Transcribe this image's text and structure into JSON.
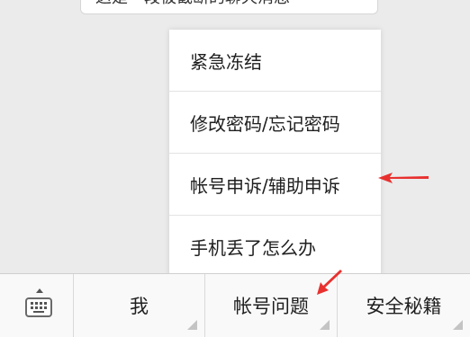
{
  "chat": {
    "partial_bubble_text": "这是一段被截断的聊天消息"
  },
  "menu": {
    "items": [
      {
        "label": "紧急冻结"
      },
      {
        "label": "修改密码/忘记密码"
      },
      {
        "label": "帐号申诉/辅助申诉"
      },
      {
        "label": "手机丢了怎么办"
      }
    ]
  },
  "bottom_bar": {
    "keyboard_icon": "keyboard-icon",
    "tabs": [
      {
        "label": "我"
      },
      {
        "label": "帐号问题"
      },
      {
        "label": "安全秘籍"
      }
    ]
  },
  "annotations": {
    "arrow_color": "#e8312f"
  }
}
